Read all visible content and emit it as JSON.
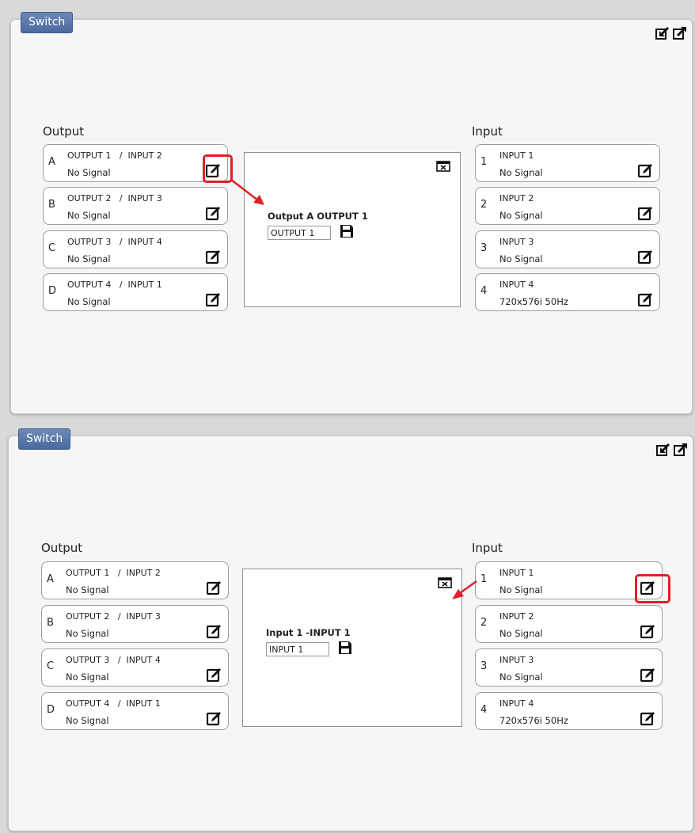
{
  "panels": [
    {
      "tag": "Switch",
      "output_title": "Output",
      "input_title": "Input",
      "outputs": [
        {
          "letter": "A",
          "line1": "OUTPUT 1   /  INPUT 2",
          "line2": "No Signal"
        },
        {
          "letter": "B",
          "line1": "OUTPUT 2   /  INPUT 3",
          "line2": "No Signal"
        },
        {
          "letter": "C",
          "line1": "OUTPUT 3   /  INPUT 4",
          "line2": "No Signal"
        },
        {
          "letter": "D",
          "line1": "OUTPUT 4   /  INPUT 1",
          "line2": "No Signal"
        }
      ],
      "inputs": [
        {
          "num": "1",
          "line1": "INPUT 1",
          "line2": "No Signal"
        },
        {
          "num": "2",
          "line1": "INPUT 2",
          "line2": "No Signal"
        },
        {
          "num": "3",
          "line1": "INPUT 3",
          "line2": "No Signal"
        },
        {
          "num": "4",
          "line1": "INPUT 4",
          "line2": "720x576i 50Hz"
        }
      ],
      "edit_label": "Output A OUTPUT 1",
      "edit_value": "OUTPUT 1"
    },
    {
      "tag": "Switch",
      "output_title": "Output",
      "input_title": "Input",
      "outputs": [
        {
          "letter": "A",
          "line1": "OUTPUT 1   /  INPUT 2",
          "line2": "No Signal"
        },
        {
          "letter": "B",
          "line1": "OUTPUT 2   /  INPUT 3",
          "line2": "No Signal"
        },
        {
          "letter": "C",
          "line1": "OUTPUT 3   /  INPUT 4",
          "line2": "No Signal"
        },
        {
          "letter": "D",
          "line1": "OUTPUT 4   /  INPUT 1",
          "line2": "No Signal"
        }
      ],
      "inputs": [
        {
          "num": "1",
          "line1": "INPUT 1",
          "line2": "No Signal"
        },
        {
          "num": "2",
          "line1": "INPUT 2",
          "line2": "No Signal"
        },
        {
          "num": "3",
          "line1": "INPUT 3",
          "line2": "No Signal"
        },
        {
          "num": "4",
          "line1": "INPUT 4",
          "line2": "720x576i 50Hz"
        }
      ],
      "edit_label": "Input 1 -INPUT 1",
      "edit_value": "INPUT 1"
    }
  ],
  "icons": {
    "export": "export-icon",
    "popout": "popout-icon",
    "edit": "edit-icon",
    "close": "close-icon",
    "save": "save-icon"
  },
  "colors": {
    "tag": "#5b79aa",
    "highlight": "#e12028",
    "panel_bg": "#f6f6f6"
  }
}
